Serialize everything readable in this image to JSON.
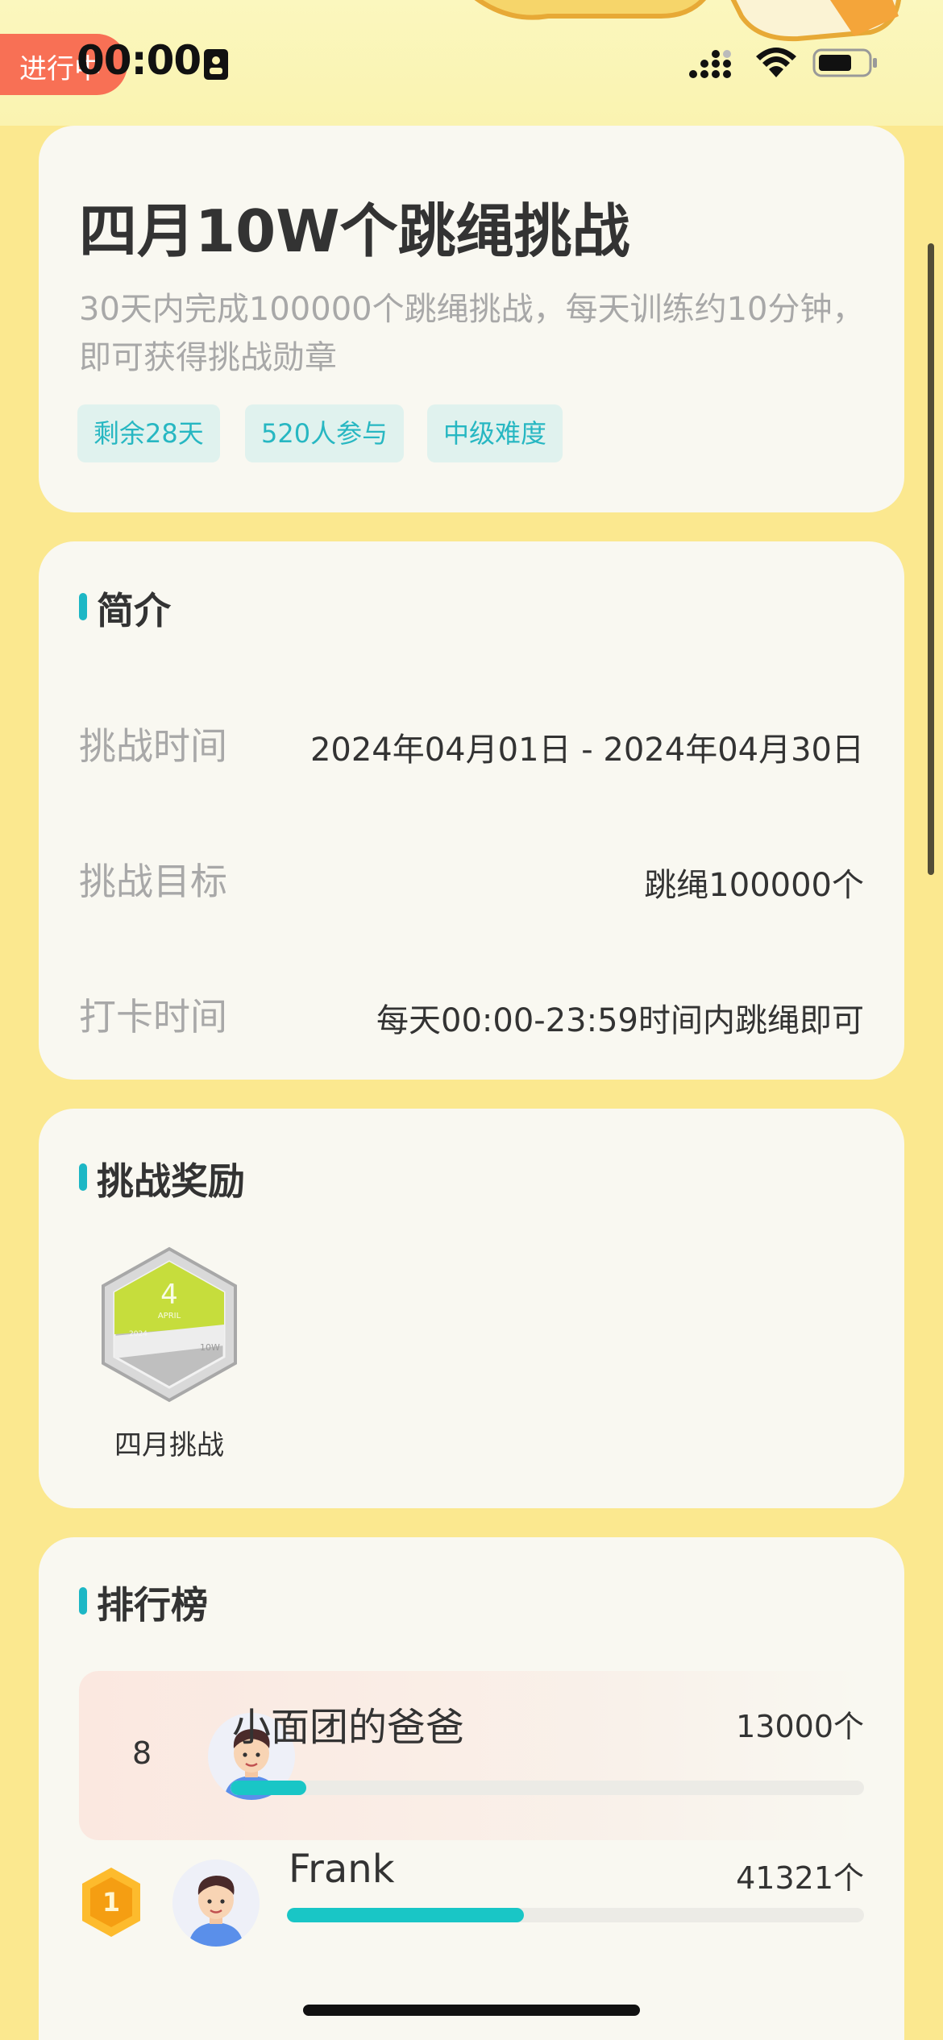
{
  "status_bar": {
    "pill_label": "进行中",
    "time": "00:00",
    "sim_icon": "sim-card-icon",
    "signal_icon": "signal-icon",
    "wifi_icon": "wifi-icon",
    "battery_icon": "battery-icon"
  },
  "nav": {
    "back_icon": "chevron-left-icon"
  },
  "header": {
    "title": "四月10W个跳绳挑战",
    "description": "30天内完成100000个跳绳挑战，每天训练约10分钟，即可获得挑战勋章",
    "tags": [
      "剩余28天",
      "520人参与",
      "中级难度"
    ]
  },
  "intro": {
    "title": "简介",
    "rows": [
      {
        "label": "挑战时间",
        "value": "2024年04月01日 - 2024年04月30日"
      },
      {
        "label": "挑战目标",
        "value": "跳绳100000个"
      },
      {
        "label": "打卡时间",
        "value": "每天00:00-23:59时间内跳绳即可"
      }
    ]
  },
  "rewards": {
    "title": "挑战奖励",
    "badge": {
      "label": "四月挑战",
      "icon": "medal-badge-icon",
      "inner_text": "4",
      "inner_sub": "APRIL",
      "inner_year": "2024",
      "inner_target": "10W"
    }
  },
  "ranking": {
    "title": "排行榜",
    "me": {
      "rank": "8",
      "name": "小面团的爸爸",
      "count": "13000个",
      "progress": 0.12
    },
    "list": [
      {
        "rank": "1",
        "name": "Frank",
        "count": "41321个",
        "progress": 0.41
      }
    ]
  },
  "colors": {
    "background": "#FBE88F",
    "accent": "#1DB7C5",
    "progress": "#19C6C6",
    "status_pill": "#F87055",
    "tag_bg": "#E0F2EE"
  }
}
